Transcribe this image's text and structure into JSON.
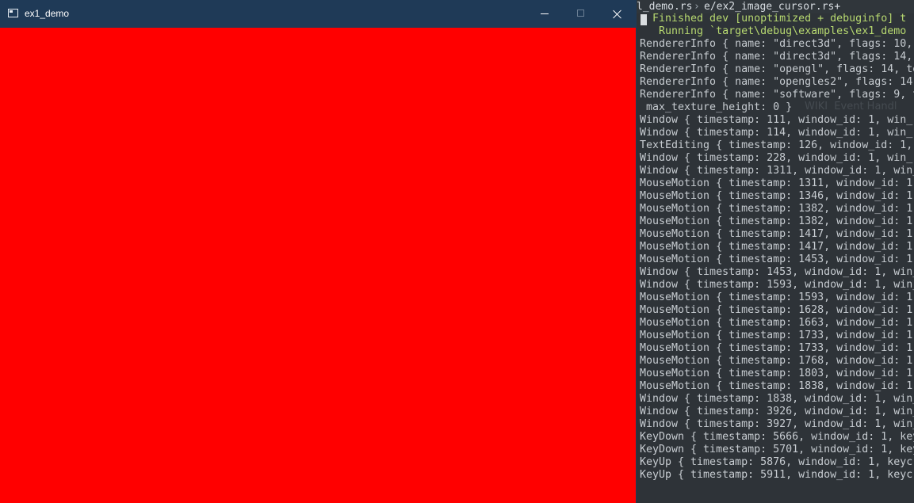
{
  "window": {
    "title": "ex1_demo",
    "canvas_color": "#ff0000",
    "titlebar_color": "#1f3a57",
    "icons": {
      "app": "window-app-icon",
      "minimize": "minimize-icon",
      "maximize": "maximize-icon",
      "close": "close-icon"
    }
  },
  "terminal": {
    "tabs": [
      "l_demo.rs",
      "e/ex2_image_cursor.rs+"
    ],
    "lines": [
      "  Finished dev [unoptimized + debuginfo] t",
      "   Running `target\\debug\\examples\\ex1_demo",
      "RendererInfo { name: \"direct3d\", flags: 10,",
      "RendererInfo { name: \"direct3d\", flags: 14,",
      "RendererInfo { name: \"opengl\", flags: 14, te",
      "RendererInfo { name: \"opengles2\", flags: 14,",
      "RendererInfo { name: \"software\", flags: 9, t",
      " max_texture_height: 0 }",
      "Window { timestamp: 111, window_id: 1, win_",
      "Window { timestamp: 114, window_id: 1, win_",
      "TextEditing { timestamp: 126, window_id: 1,",
      "Window { timestamp: 228, window_id: 1, win_",
      "Window { timestamp: 1311, window_id: 1, win_",
      "MouseMotion { timestamp: 1311, window_id: 1",
      "MouseMotion { timestamp: 1346, window_id: 1",
      "MouseMotion { timestamp: 1382, window_id: 1",
      "MouseMotion { timestamp: 1382, window_id: 1",
      "MouseMotion { timestamp: 1417, window_id: 1",
      "MouseMotion { timestamp: 1417, window_id: 1",
      "MouseMotion { timestamp: 1453, window_id: 1",
      "Window { timestamp: 1453, window_id: 1, win_",
      "Window { timestamp: 1593, window_id: 1, win_",
      "MouseMotion { timestamp: 1593, window_id: 1",
      "MouseMotion { timestamp: 1628, window_id: 1",
      "MouseMotion { timestamp: 1663, window_id: 1",
      "MouseMotion { timestamp: 1733, window_id: 1",
      "MouseMotion { timestamp: 1733, window_id: 1",
      "MouseMotion { timestamp: 1768, window_id: 1",
      "MouseMotion { timestamp: 1803, window_id: 1",
      "MouseMotion { timestamp: 1838, window_id: 1",
      "Window { timestamp: 1838, window_id: 1, win_",
      "Window { timestamp: 3926, window_id: 1, win_",
      "Window { timestamp: 3927, window_id: 1, win_",
      "KeyDown { timestamp: 5666, window_id: 1, key",
      "KeyDown { timestamp: 5701, window_id: 1, key",
      "KeyUp { timestamp: 5876, window_id: 1, keyc",
      "KeyUp { timestamp: 5911, window_id: 1, keyc"
    ],
    "ghost_text": "WIKI  Event Handl"
  }
}
